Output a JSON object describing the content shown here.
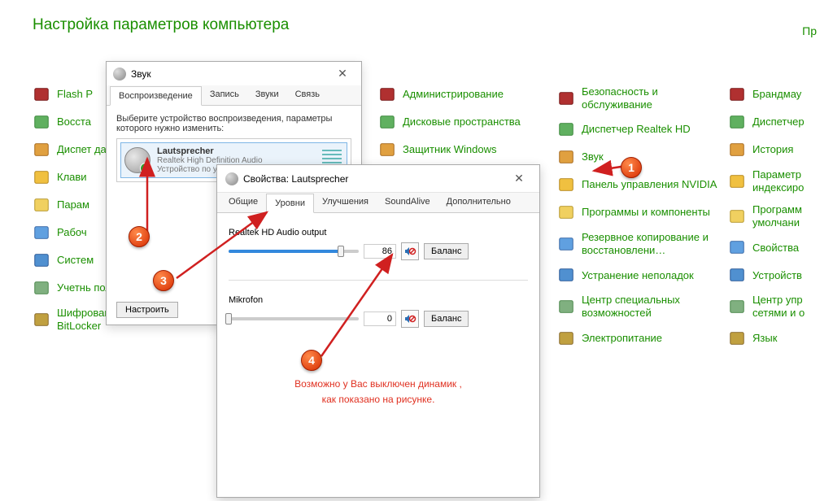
{
  "header": {
    "title": "Настройка параметров компьютера",
    "right": "Пр"
  },
  "cp_col1": [
    {
      "name": "Flash P"
    },
    {
      "name": "Восста"
    },
    {
      "name": "Диспет данных"
    },
    {
      "name": "Клави"
    },
    {
      "name": "Парам"
    },
    {
      "name": "Рабоч"
    },
    {
      "name": "Систем"
    },
    {
      "name": "Учетнь польз"
    },
    {
      "name": "Шифрование диска BitLocker"
    }
  ],
  "cp_col2": [
    {
      "name": "Администрирование"
    },
    {
      "name": "Дисковые пространства"
    },
    {
      "name": "Защитник Windows"
    }
  ],
  "cp_col3": [
    {
      "name": "Безопасность и обслуживание"
    },
    {
      "name": "Диспетчер Realtek HD"
    },
    {
      "name": "Звук"
    },
    {
      "name": "Панель управления NVIDIA"
    },
    {
      "name": "Программы и компоненты"
    },
    {
      "name": "Резервное копирование и восстановлени…"
    },
    {
      "name": "Устранение неполадок"
    },
    {
      "name": "Центр специальных возможностей"
    },
    {
      "name": "Электропитание"
    }
  ],
  "cp_col4": [
    {
      "name": "Брандмау"
    },
    {
      "name": "Диспетчер"
    },
    {
      "name": "История"
    },
    {
      "name": "Параметр индексиро"
    },
    {
      "name": "Программ умолчани"
    },
    {
      "name": "Свойства"
    },
    {
      "name": "Устройств"
    },
    {
      "name": "Центр упр сетями и о"
    },
    {
      "name": "Язык"
    }
  ],
  "sound_dialog": {
    "title": "Звук",
    "tabs": [
      "Воспроизведение",
      "Запись",
      "Звуки",
      "Связь"
    ],
    "active_tab": 0,
    "instruction": "Выберите устройство воспроизведения, параметры которого нужно изменить:",
    "device": {
      "name": "Lautsprecher",
      "driver": "Realtek High Definition Audio",
      "status": "Устройство по умолчанию"
    },
    "configure_btn": "Настроить"
  },
  "props_dialog": {
    "title": "Свойства: Lautsprecher",
    "tabs": [
      "Общие",
      "Уровни",
      "Улучшения",
      "SoundAlive",
      "Дополнительно"
    ],
    "active_tab": 1,
    "output": {
      "label": "Realtek HD Audio output",
      "value": "86",
      "percent": 86,
      "balance": "Баланс"
    },
    "mic": {
      "label": "Mikrofon",
      "value": "0",
      "percent": 0,
      "balance": "Баланс"
    },
    "note_line1": "Возможно у Вас выключен динамик ,",
    "note_line2": "как показано на рисунке."
  },
  "badges": {
    "b1": "1",
    "b2": "2",
    "b3": "3",
    "b4": "4"
  }
}
